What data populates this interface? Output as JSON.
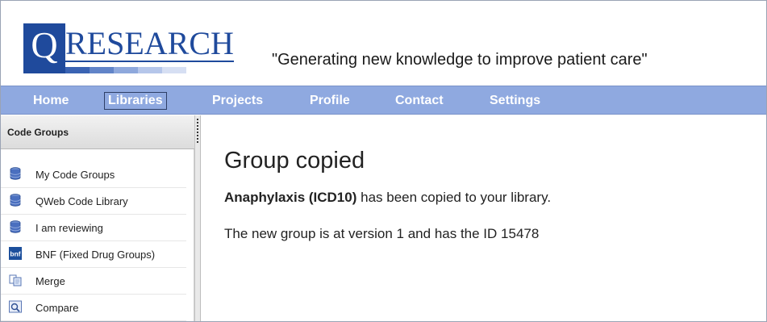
{
  "header": {
    "logo_letter": "Q",
    "logo_word": "RESEARCH",
    "tagline": "\"Generating new knowledge to improve patient care\""
  },
  "nav": {
    "items": [
      {
        "label": "Home"
      },
      {
        "label": "Libraries",
        "active": true
      },
      {
        "label": "Projects"
      },
      {
        "label": "Profile"
      },
      {
        "label": "Contact"
      },
      {
        "label": "Settings"
      }
    ]
  },
  "sidebar": {
    "title": "Code Groups",
    "items": [
      {
        "label": "My Code Groups",
        "icon": "database-icon"
      },
      {
        "label": "QWeb Code Library",
        "icon": "database-icon"
      },
      {
        "label": "I am reviewing",
        "icon": "database-icon"
      },
      {
        "label": "BNF (Fixed Drug Groups)",
        "icon": "bnf-icon",
        "icon_text": "bnf"
      },
      {
        "label": "Merge",
        "icon": "merge-icon"
      },
      {
        "label": "Compare",
        "icon": "compare-icon"
      }
    ]
  },
  "main": {
    "title": "Group copied",
    "group_name": "Anaphylaxis (ICD10)",
    "copied_text": " has been copied to your library.",
    "version_text": "The new group is at version 1 and has the ID 15478"
  },
  "colors": {
    "brand": "#1f4a9c",
    "nav_bg": "#8fa9e0"
  }
}
